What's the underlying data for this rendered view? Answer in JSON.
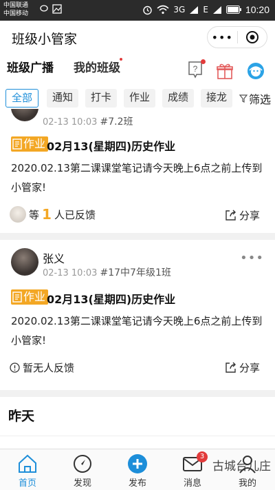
{
  "status": {
    "carrier1": "中国联通",
    "carrier2": "中国移动",
    "net1": "3G",
    "net2": "E",
    "time": "10:20"
  },
  "app": {
    "title": "班级小管家"
  },
  "tabs": [
    {
      "label": "班级广播"
    },
    {
      "label": "我的班级"
    }
  ],
  "filters": {
    "chips": [
      {
        "label": "全部"
      },
      {
        "label": "通知"
      },
      {
        "label": "打卡"
      },
      {
        "label": "作业"
      },
      {
        "label": "成绩"
      },
      {
        "label": "接龙"
      }
    ],
    "filter_label": "筛选"
  },
  "posts": [
    {
      "time": "02-13 10:03",
      "class": "#7.2班",
      "tag": "作业",
      "title": "02月13(星期四)历史作业",
      "body": "2020.02.13第二课课堂笔记请今天晚上6点之前上传到小管家!",
      "feedback_prefix": "等",
      "feedback_count": "1",
      "feedback_suffix": "人已反馈",
      "share": "分享"
    },
    {
      "author": "张义",
      "time": "02-13 10:03",
      "class": "#17中7年级1班",
      "tag": "作业",
      "title": "02月13(星期四)历史作业",
      "body": "2020.02.13第二课课堂笔记请今天晚上6点之前上传到小管家!",
      "feedback": "暂无人反馈",
      "share": "分享"
    }
  ],
  "section_yesterday": "昨天",
  "nav": [
    {
      "label": "首页"
    },
    {
      "label": "发现"
    },
    {
      "label": "发布"
    },
    {
      "label": "消息",
      "badge": "3"
    },
    {
      "label": "我的"
    }
  ],
  "watermark": "古城台儿庄",
  "colors": {
    "accent": "#1d8ed9",
    "tag": "#f3a724",
    "badge": "#e23b3b"
  }
}
